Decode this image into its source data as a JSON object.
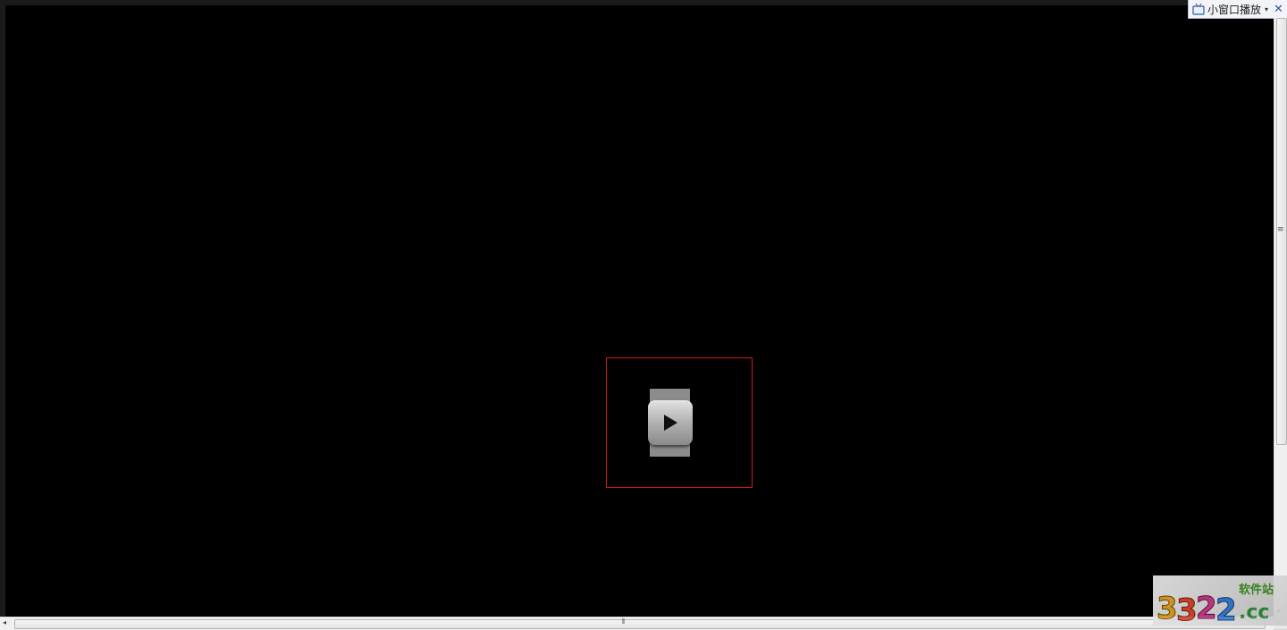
{
  "mini_bar": {
    "label": "小窗口播放",
    "dropdown_glyph": "▾",
    "close_glyph": "✕"
  },
  "scrollbars": {
    "vertical_grip": "≡",
    "horizontal_grip": "⦀",
    "arrow_left": "◂",
    "arrow_down": "▾"
  },
  "player": {
    "play_icon": "play-icon"
  },
  "watermark": {
    "logo": "3322.cc",
    "subtitle": "软件站"
  },
  "colors": {
    "video_background": "#000000",
    "play_box_border": "#d01818",
    "close_icon": "#2c5aa0",
    "watermark_green": "#3d8a1f"
  }
}
